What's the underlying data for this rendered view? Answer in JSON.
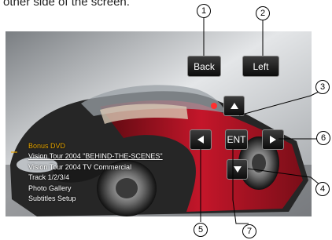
{
  "caption": "other side of the screen.",
  "osd": {
    "back_label": "Back",
    "left_label": "Left",
    "enter_label": "ENT"
  },
  "menu": {
    "title": "Bonus DVD",
    "items": [
      "Vision Tour 2004 \"BEHIND-THE-SCENES\"",
      "Vision Tour 2004 TV Commercial",
      "Track 1/2/3/4",
      "Photo Gallery",
      "Subtitles Setup"
    ],
    "selected_index": 0
  },
  "callouts": [
    "1",
    "2",
    "3",
    "4",
    "5",
    "6",
    "7"
  ],
  "colors": {
    "menu_title": "#e8a600",
    "car_red": "#c4162a",
    "button_bg": "#111111"
  },
  "icons": [
    "arrow-up-icon",
    "arrow-down-icon",
    "arrow-left-icon",
    "arrow-right-icon"
  ]
}
